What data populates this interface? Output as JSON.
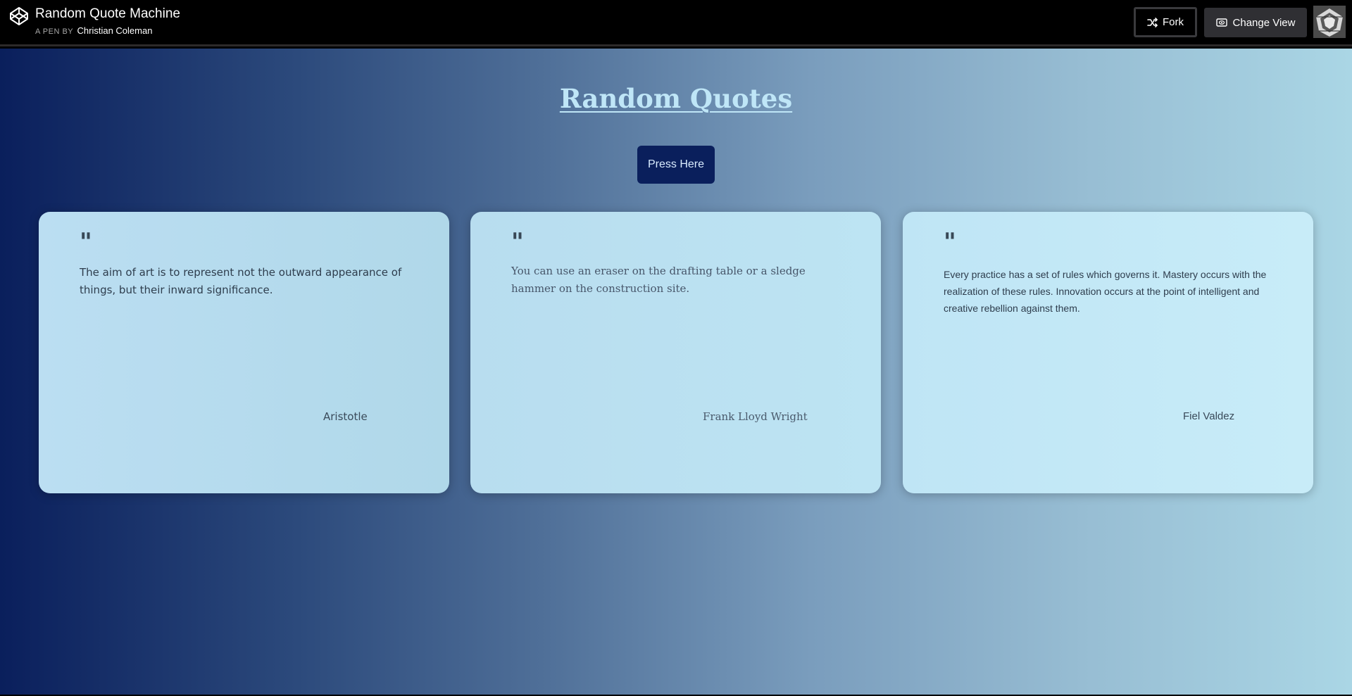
{
  "header": {
    "pen_title": "Random Quote Machine",
    "byline_prefix": "A PEN BY",
    "author": "Christian Coleman",
    "fork_label": "Fork",
    "change_view_label": "Change View",
    "icons": {
      "logo": "codepen-logo-icon",
      "fork": "fork-icon",
      "change_view": "eye-icon",
      "avatar": "user-avatar"
    }
  },
  "main": {
    "heading": "Random Quotes",
    "button_label": "Press Here",
    "quote_mark": "\"",
    "cards": [
      {
        "text": "The aim of art is to represent not the outward appearance of things, but their inward significance.",
        "author": "Aristotle"
      },
      {
        "text": "You can use an eraser on the drafting table or a sledge hammer on the construction site.",
        "author": "Frank Lloyd Wright"
      },
      {
        "text": "Every practice has a set of rules which governs it. Mastery occurs with the realization of these rules. Innovation occurs at the point of intelligent and creative rebellion against them.",
        "author": "Fiel Valdez"
      }
    ]
  },
  "colors": {
    "header_bg": "#000000",
    "gradient_start": "#0a1f5c",
    "gradient_end": "#aad6e5",
    "button_bg": "#0a1f5c",
    "heading_color": "#bfe6f7",
    "card_bg": "#bde1f1"
  }
}
